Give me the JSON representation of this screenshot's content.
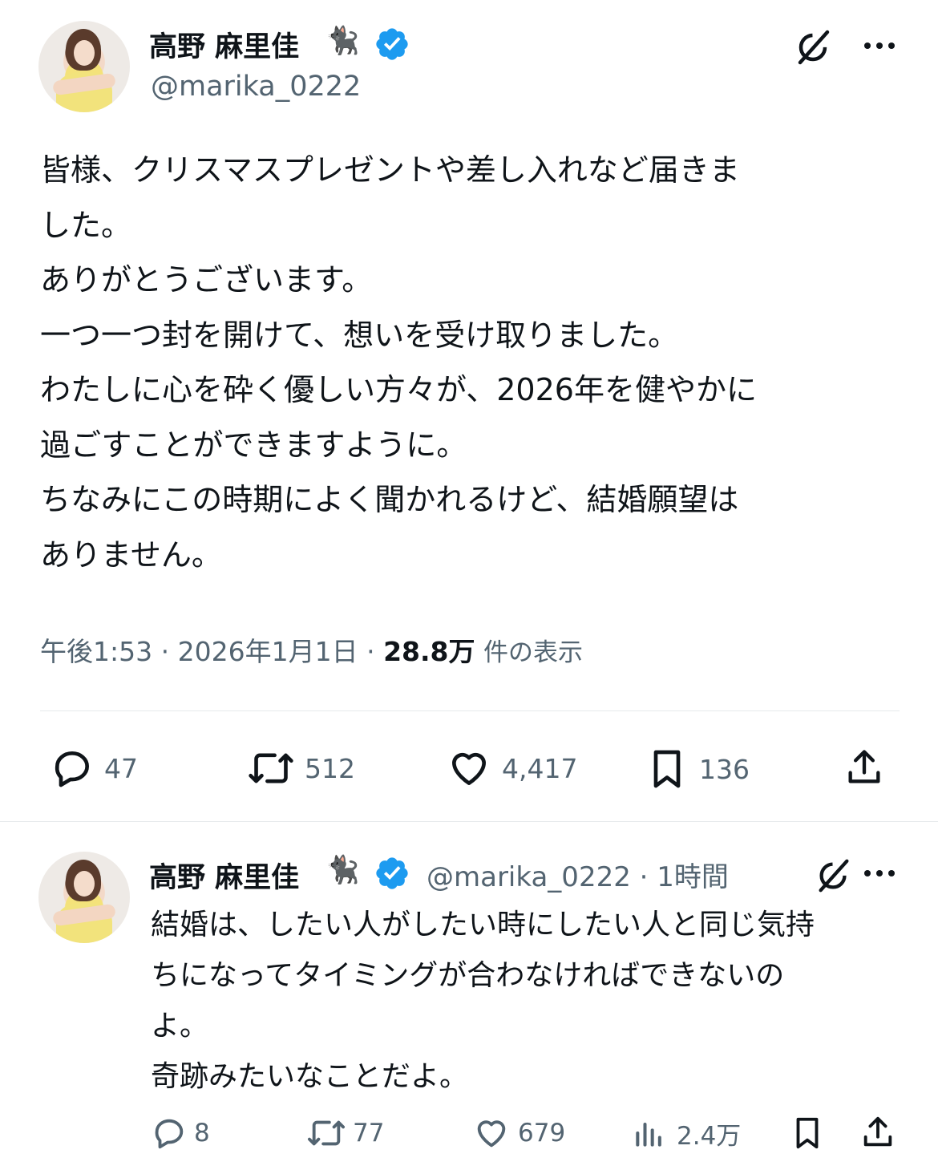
{
  "main_tweet": {
    "display_name": "高野 麻里佳",
    "emoji": "🐈‍⬛",
    "handle": "@marika_0222",
    "text": "皆様、クリスマスプレゼントや差し入れなど届きま\nした。\nありがとうございます。\n一つ一つ封を開けて、想いを受け取りました。\nわたしに心を砕く優しい方々が、2026年を健やかに\n過ごすことができますように。\nちなみにこの時期によく聞かれるけど、結婚願望は\nありません。",
    "time": "午後1:53",
    "date": "2026年1月1日",
    "views_count": "28.8万",
    "views_label": "件の表示",
    "separator": "·",
    "stats": {
      "replies": "47",
      "reposts": "512",
      "likes": "4,417",
      "bookmarks": "136"
    }
  },
  "reply_tweet": {
    "display_name": "高野 麻里佳",
    "emoji": "🐈‍⬛",
    "handle": "@marika_0222",
    "relative_time": "1時間",
    "separator": "·",
    "text": "結婚は、したい人がしたい時にしたい人と同じ気持\nちになってタイミングが合わなければできないの\nよ。\n奇跡みたいなことだよ。",
    "stats": {
      "replies": "8",
      "reposts": "77",
      "likes": "679",
      "views": "2.4万"
    }
  },
  "colors": {
    "text": "#0f1419",
    "secondary": "#536471",
    "verified": "#1d9bf0",
    "divider": "#e6e9ec"
  },
  "icons": [
    "grok-icon",
    "more-icon",
    "verified-badge-icon",
    "reply-icon",
    "repost-icon",
    "like-icon",
    "bookmark-icon",
    "share-icon",
    "views-icon"
  ]
}
